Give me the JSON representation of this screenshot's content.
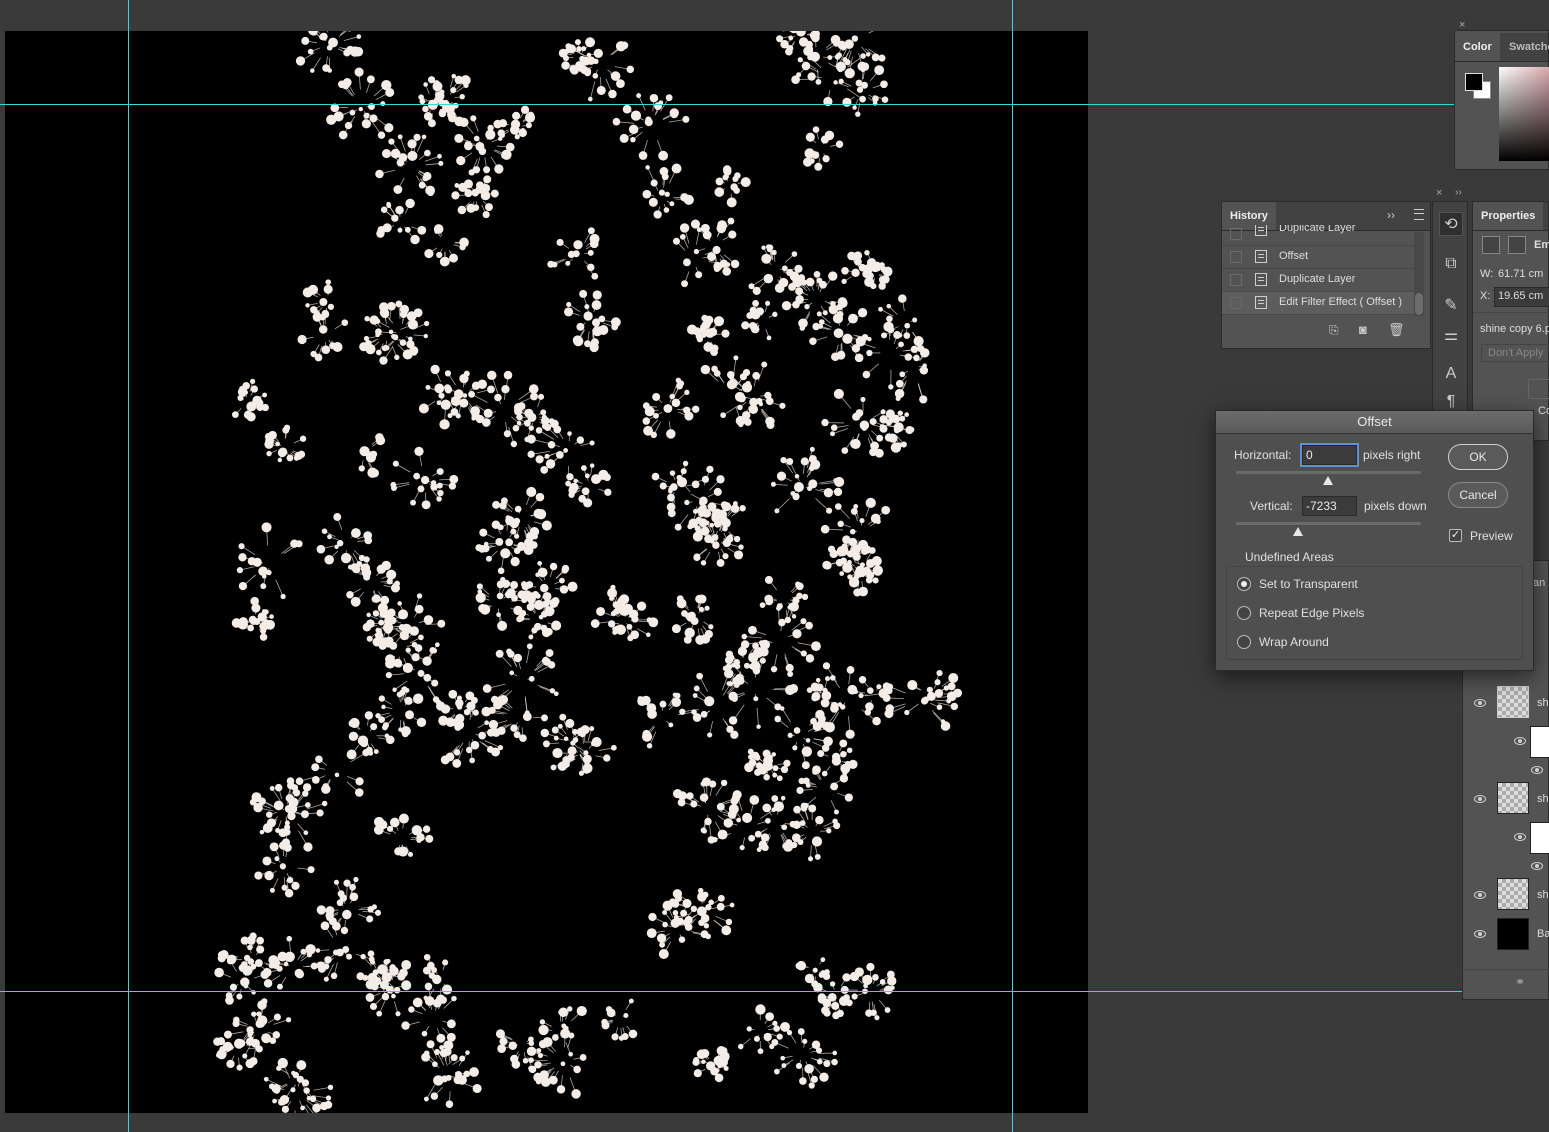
{
  "colors": {
    "guide": "#3ad6e0",
    "canvas_bg": "#000000",
    "flower": "#f4ece6"
  },
  "color_panel": {
    "tabs": [
      "Color",
      "Swatches"
    ],
    "tab_visible_labels": [
      "Color",
      "Swatche"
    ],
    "close": "×"
  },
  "history": {
    "title": "History",
    "items": [
      {
        "label": "Duplicate Layer"
      },
      {
        "label": "Offset"
      },
      {
        "label": "Duplicate Layer"
      },
      {
        "label": "Edit Filter Effect ( Offset )"
      }
    ],
    "collapse": "››"
  },
  "properties": {
    "title": "Properties",
    "type_label": "Em",
    "w_label": "W:",
    "w_value": "61.71 cm",
    "x_label": "X:",
    "x_value": "19.65 cm",
    "layer_name": "shine copy 6.p",
    "dont_apply": "Don't Apply",
    "co_label": "Co"
  },
  "layers": {
    "items": [
      {
        "name": "sh"
      },
      {
        "name": "sh"
      },
      {
        "name": "sh"
      },
      {
        "name": "Ba"
      }
    ],
    "partial_label": "an"
  },
  "offset_dialog": {
    "title": "Offset",
    "horizontal_label": "Horizontal:",
    "horizontal_value": "0",
    "horizontal_unit": "pixels right",
    "vertical_label": "Vertical:",
    "vertical_value": "-7233",
    "vertical_unit": "pixels down",
    "ok": "OK",
    "cancel": "Cancel",
    "preview_label": "Preview",
    "preview_checked": true,
    "undefined_areas_title": "Undefined Areas",
    "options": [
      {
        "label": "Set to Transparent",
        "selected": true
      },
      {
        "label": "Repeat Edge Pixels",
        "selected": false
      },
      {
        "label": "Wrap Around",
        "selected": false
      }
    ]
  }
}
